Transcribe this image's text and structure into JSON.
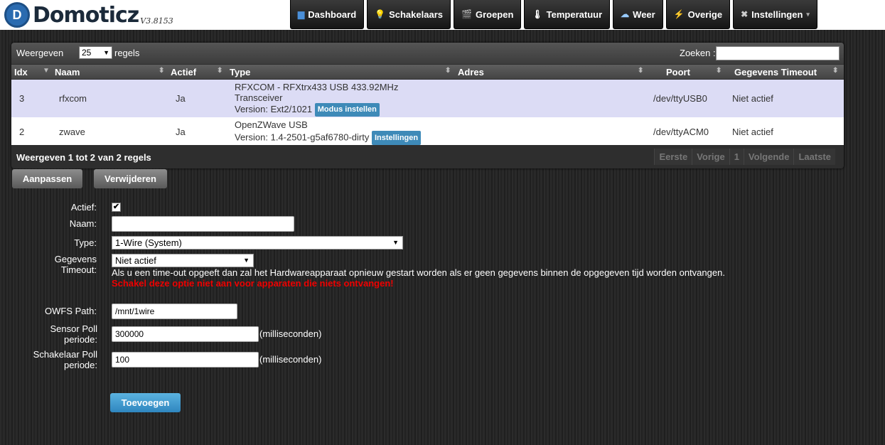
{
  "app": {
    "logo_letter": "D",
    "name": "Domoticz",
    "version": "V3.8153",
    "brand_color": "#2a6bb0"
  },
  "nav": [
    {
      "label": "Dashboard",
      "icon": "dashboard-icon",
      "glyph": "▆"
    },
    {
      "label": "Schakelaars",
      "icon": "lightbulb-icon",
      "glyph": "💡"
    },
    {
      "label": "Groepen",
      "icon": "scenes-icon",
      "glyph": "🎬"
    },
    {
      "label": "Temperatuur",
      "icon": "thermometer-icon",
      "glyph": "🌡"
    },
    {
      "label": "Weer",
      "icon": "weather-icon",
      "glyph": "☁"
    },
    {
      "label": "Overige",
      "icon": "utility-icon",
      "glyph": "⚡"
    },
    {
      "label": "Instellingen",
      "icon": "tools-icon",
      "glyph": "✖",
      "caret": "▾"
    }
  ],
  "table": {
    "show_label": "Weergeven",
    "page_length": "25",
    "rows_label": "regels",
    "search_label": "Zoeken :",
    "search_value": "",
    "columns": [
      "Idx",
      "Naam",
      "Actief",
      "Type",
      "Adres",
      "Poort",
      "Gegevens Timeout"
    ],
    "rows": [
      {
        "idx": "3",
        "name": "rfxcom",
        "active": "Ja",
        "type_line1": "RFXCOM - RFXtrx433 USB 433.92MHz",
        "type_line2": "Transceiver",
        "type_line3": "Version: Ext2/1021",
        "button": "Modus instellen",
        "address": "",
        "port": "/dev/ttyUSB0",
        "timeout": "Niet actief"
      },
      {
        "idx": "2",
        "name": "zwave",
        "active": "Ja",
        "type_line1": "OpenZWave USB",
        "type_line2": "Version: 1.4-2501-g5af6780-dirty",
        "button": "Instellingen",
        "address": "",
        "port": "/dev/ttyACM0",
        "timeout": "Niet actief"
      }
    ],
    "info": "Weergeven 1 tot 2 van 2 regels",
    "pager": [
      "Eerste",
      "Vorige",
      "1",
      "Volgende",
      "Laatste"
    ]
  },
  "actions": {
    "update": "Aanpassen",
    "delete": "Verwijderen"
  },
  "form": {
    "active_label": "Actief:",
    "active_checked": "✔",
    "name_label": "Naam:",
    "name_value": "",
    "type_label": "Type:",
    "type_value": "1-Wire (System)",
    "timeout_label_1": "Gegevens",
    "timeout_label_2": "Timeout:",
    "timeout_value": "Niet actief",
    "timeout_note": "Als u een time-out opgeeft dan zal het Hardwareapparaat opnieuw gestart worden als er geen gegevens binnen de opgegeven tijd worden ontvangen.",
    "timeout_warning": "Schakel deze optie niet aan voor apparaten die niets ontvangen!",
    "owfs_label": "OWFS Path:",
    "owfs_value": "/mnt/1wire",
    "sensor_poll_label_1": "Sensor Poll",
    "sensor_poll_label_2": "periode:",
    "sensor_poll_value": "300000",
    "switch_poll_label_1": "Schakelaar Poll",
    "switch_poll_label_2": "periode:",
    "switch_poll_value": "100",
    "unit": "(milliseconden)",
    "add_button": "Toevoegen"
  }
}
